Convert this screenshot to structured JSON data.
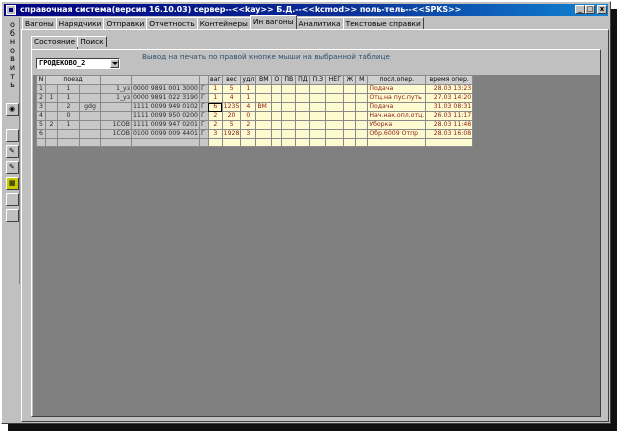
{
  "window": {
    "title": "справочная система(версия 16.10.03) сервер--<<kay>> Б.Д.--<<kcmod>> поль-тель--<<SPKS>>",
    "controls": [
      "_",
      "□",
      "x"
    ]
  },
  "toolbar": {
    "vertical_label": [
      "о",
      "б",
      "н",
      "о",
      "в",
      "и",
      "т",
      "ь"
    ]
  },
  "tabs": [
    "Вагоны",
    "Нарядчики",
    "Отправки",
    "Отчетность",
    "Контейнеры",
    "Ин вагоны",
    "Аналитика",
    "Текстовые справки"
  ],
  "active_tab": "Ин вагоны",
  "subtabs": [
    "Состояние",
    "Поиск"
  ],
  "hint": "Вывод на печать по правой кнопке мыши на выбранной таблице",
  "station_select": {
    "value": "ГРОДЕКОВО_2"
  },
  "grid": {
    "headers": [
      "N",
      "поезд",
      "",
      "",
      "",
      "",
      "ваг",
      "вес",
      "удл",
      "ВМ",
      "О",
      "ПВ",
      "ПД",
      "П.З",
      "НЕГ",
      "Ж",
      "М",
      "посл.опер.",
      "время опер."
    ],
    "rows": [
      {
        "n": "1",
        "a": "",
        "b": "1",
        "c": "",
        "d": "1_уз",
        "e": "0000 9891 001 3000",
        "f": "Г",
        "vag": "1",
        "ves": "5",
        "udl": "1",
        "vm": "",
        "o": "",
        "pv": "",
        "pd": "",
        "pz": "",
        "neg": "",
        "zh": "",
        "m": "",
        "op": "Подача",
        "time": "28.03 13:23"
      },
      {
        "n": "2",
        "a": "1",
        "b": "1",
        "c": "",
        "d": "1_уз",
        "e": "0000 9891 022 3190",
        "f": "Г",
        "vag": "1",
        "ves": "4",
        "udl": "1",
        "vm": "",
        "o": "",
        "pv": "",
        "pd": "",
        "pz": "",
        "neg": "",
        "zh": "",
        "m": "",
        "op": "Отц.на пус.путь",
        "time": "27.03 14:20"
      },
      {
        "n": "3",
        "a": "",
        "b": "2",
        "c": "gdg",
        "d": "",
        "e": "1111 0099 949 0102",
        "f": "Г",
        "vag": "6",
        "ves": "1235",
        "udl": "4",
        "vm": "ВМ",
        "o": "",
        "pv": "",
        "pd": "",
        "pz": "",
        "neg": "",
        "zh": "",
        "m": "",
        "op": "Подача",
        "time": "31.03 08:31"
      },
      {
        "n": "4",
        "a": "",
        "b": "0",
        "c": "",
        "d": "",
        "e": "1111 0099 950 0200",
        "f": "Г",
        "vag": "2",
        "ves": "20",
        "udl": "0",
        "vm": "",
        "o": "",
        "pv": "",
        "pd": "",
        "pz": "",
        "neg": "",
        "zh": "",
        "m": "",
        "op": "Нач.нак.опл.отц.",
        "time": "26.03 11:17"
      },
      {
        "n": "5",
        "a": "2",
        "b": "1",
        "c": "",
        "d": "1СОВ",
        "e": "1111 0099 947 0201",
        "f": "Г",
        "vag": "2",
        "ves": "5",
        "udl": "2",
        "vm": "",
        "o": "",
        "pv": "",
        "pd": "",
        "pz": "",
        "neg": "",
        "zh": "",
        "m": "",
        "op": "Уборка",
        "time": "28.03 11:48"
      },
      {
        "n": "6",
        "a": "",
        "b": "",
        "c": "",
        "d": "1СОВ",
        "e": "0100 0099 009 4401",
        "f": "Г",
        "vag": "3",
        "ves": "1928",
        "udl": "3",
        "vm": "",
        "o": "",
        "pv": "",
        "pd": "",
        "pz": "",
        "neg": "",
        "zh": "",
        "m": "",
        "op": "Обр.6009 Отпр",
        "time": "28.03 16:08"
      }
    ]
  }
}
